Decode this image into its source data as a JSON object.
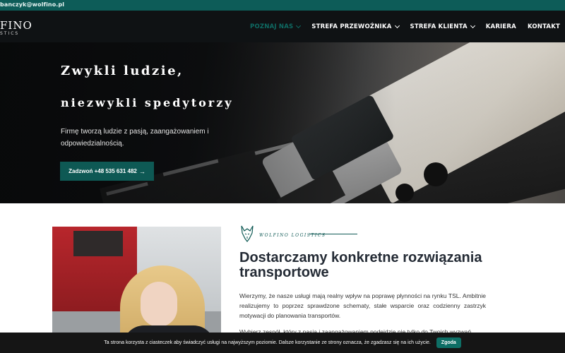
{
  "topbar": {
    "email": "banczyk@wolfino.pl"
  },
  "logo": {
    "main": "FINO",
    "sub": "STICS"
  },
  "nav": {
    "items": [
      {
        "label": "POZNAJ NAS",
        "dropdown": true,
        "active": true
      },
      {
        "label": "STREFA PRZEWOŹNIKA",
        "dropdown": true,
        "active": false
      },
      {
        "label": "STREFA KLIENTA",
        "dropdown": true,
        "active": false
      },
      {
        "label": "KARIERA",
        "dropdown": false,
        "active": false
      },
      {
        "label": "KONTAKT",
        "dropdown": false,
        "active": false
      }
    ]
  },
  "hero": {
    "title_line1": "Zwykli ludzie,",
    "title_line2": "niezwykli spedytorzy",
    "text": "Firmę tworzą ludzie z pasją, zaangażowaniem i odpowiedzialnością.",
    "button_label": "Zadzwoń +48 535 631 482",
    "button_icon": "arrow-right-icon"
  },
  "about": {
    "brand_label": "WOLFINO LOGISTICS",
    "title": "Dostarczamy konkretne rozwiązania transportowe",
    "paragraph1": "Wierzymy, że nasze usługi mają realny wpływ na poprawę płynności na rynku TSL. Ambitnie realizujemy to poprzez sprawdzone schematy, stałe wsparcie oraz codzienny zastrzyk motywacji do planowania transportów.",
    "paragraph2": "Wybierz zespół, który z pasją i zaangażowaniem podejdzie nie tylko do Twoich wyzwań"
  },
  "cookie": {
    "text": "Ta strona korzysta z ciasteczek aby świadczyć usługi na najwyższym poziomie. Dalsze korzystanie ze strony oznacza, że zgadzasz się na ich użycie.",
    "accept_label": "Zgoda"
  },
  "colors": {
    "brand_teal": "#0e5954",
    "topbar": "#0d5c58",
    "header_bg": "#0f1214",
    "title_text": "#242b35",
    "cookie_bg": "#151515"
  }
}
